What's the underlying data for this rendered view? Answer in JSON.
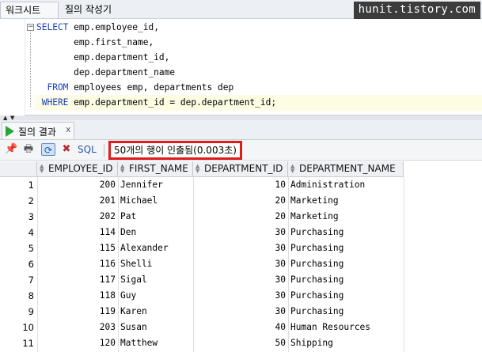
{
  "tabs": {
    "worksheet": "워크시트",
    "query_builder": "질의 작성기"
  },
  "watermark": "hunit.tistory.com",
  "editor": {
    "lines": [
      {
        "kw": "SELECT",
        "rest": " emp.employee_id,"
      },
      {
        "kw": "",
        "rest": "       emp.first_name,"
      },
      {
        "kw": "",
        "rest": "       emp.department_id,"
      },
      {
        "kw": "",
        "rest": "       dep.department_name"
      },
      {
        "kw": "  FROM",
        "rest": " employees emp, departments dep"
      },
      {
        "kw": " WHERE",
        "rest": " emp.department_id = dep.department_id;"
      }
    ]
  },
  "result_tab": {
    "label": "질의 결과",
    "close": "x"
  },
  "toolbar": {
    "sql_label": "SQL",
    "status": "50개의 행이 인출됨(0.003초)"
  },
  "grid": {
    "columns": [
      "EMPLOYEE_ID",
      "FIRST_NAME",
      "DEPARTMENT_ID",
      "DEPARTMENT_NAME"
    ],
    "rows": [
      {
        "n": "1",
        "id": "200",
        "name": "Jennifer",
        "dept": "10",
        "dname": "Administration"
      },
      {
        "n": "2",
        "id": "201",
        "name": "Michael",
        "dept": "20",
        "dname": "Marketing"
      },
      {
        "n": "3",
        "id": "202",
        "name": "Pat",
        "dept": "20",
        "dname": "Marketing"
      },
      {
        "n": "4",
        "id": "114",
        "name": "Den",
        "dept": "30",
        "dname": "Purchasing"
      },
      {
        "n": "5",
        "id": "115",
        "name": "Alexander",
        "dept": "30",
        "dname": "Purchasing"
      },
      {
        "n": "6",
        "id": "116",
        "name": "Shelli",
        "dept": "30",
        "dname": "Purchasing"
      },
      {
        "n": "7",
        "id": "117",
        "name": "Sigal",
        "dept": "30",
        "dname": "Purchasing"
      },
      {
        "n": "8",
        "id": "118",
        "name": "Guy",
        "dept": "30",
        "dname": "Purchasing"
      },
      {
        "n": "9",
        "id": "119",
        "name": "Karen",
        "dept": "30",
        "dname": "Purchasing"
      },
      {
        "n": "10",
        "id": "203",
        "name": "Susan",
        "dept": "40",
        "dname": "Human Resources"
      },
      {
        "n": "11",
        "id": "120",
        "name": "Matthew",
        "dept": "50",
        "dname": "Shipping"
      }
    ]
  },
  "colors": {
    "keyword": "#1a3ec0",
    "status_border": "#e11b1b",
    "run_icon": "#2aa339"
  }
}
